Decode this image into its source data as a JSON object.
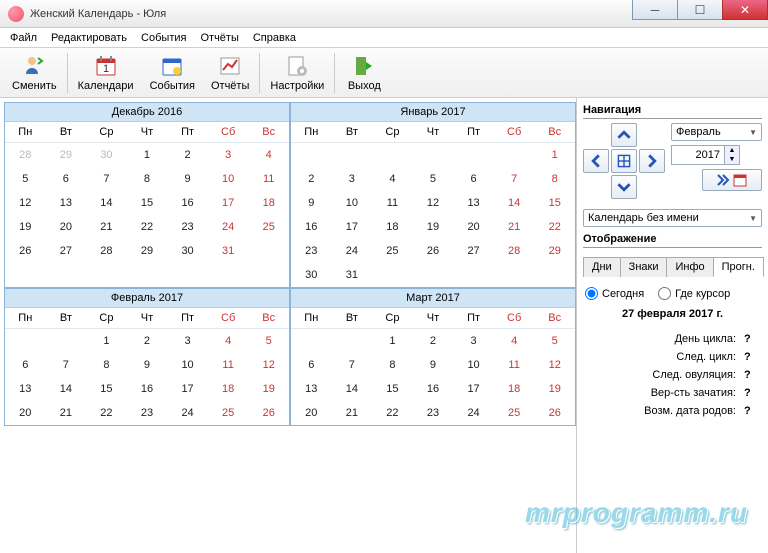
{
  "window": {
    "title": "Женский Календарь - Юля"
  },
  "menu": {
    "file": "Файл",
    "edit": "Редактировать",
    "events": "События",
    "reports": "Отчёты",
    "help": "Справка"
  },
  "toolbar": {
    "change": "Сменить",
    "calendars": "Календари",
    "events": "События",
    "reports": "Отчёты",
    "settings": "Настройки",
    "exit": "Выход"
  },
  "dow": [
    "Пн",
    "Вт",
    "Ср",
    "Чт",
    "Пт",
    "Сб",
    "Вс"
  ],
  "months": [
    {
      "title": "Декабрь  2016",
      "cells": [
        {
          "d": "28",
          "o": 1
        },
        {
          "d": "29",
          "o": 1
        },
        {
          "d": "30",
          "o": 1
        },
        {
          "d": "1"
        },
        {
          "d": "2"
        },
        {
          "d": "3",
          "w": 1
        },
        {
          "d": "4",
          "w": 1
        },
        {
          "d": "5"
        },
        {
          "d": "6"
        },
        {
          "d": "7"
        },
        {
          "d": "8"
        },
        {
          "d": "9"
        },
        {
          "d": "10",
          "w": 1
        },
        {
          "d": "11",
          "w": 1
        },
        {
          "d": "12"
        },
        {
          "d": "13"
        },
        {
          "d": "14"
        },
        {
          "d": "15"
        },
        {
          "d": "16"
        },
        {
          "d": "17",
          "w": 1
        },
        {
          "d": "18",
          "w": 1
        },
        {
          "d": "19"
        },
        {
          "d": "20"
        },
        {
          "d": "21"
        },
        {
          "d": "22"
        },
        {
          "d": "23"
        },
        {
          "d": "24",
          "w": 1
        },
        {
          "d": "25",
          "w": 1
        },
        {
          "d": "26"
        },
        {
          "d": "27"
        },
        {
          "d": "28"
        },
        {
          "d": "29"
        },
        {
          "d": "30"
        },
        {
          "d": "31",
          "w": 1
        },
        {
          "d": "",
          "e": 1
        }
      ]
    },
    {
      "title": "Январь  2017",
      "cells": [
        {
          "d": "",
          "e": 1
        },
        {
          "d": "",
          "e": 1
        },
        {
          "d": "",
          "e": 1
        },
        {
          "d": "",
          "e": 1
        },
        {
          "d": "",
          "e": 1
        },
        {
          "d": "",
          "e": 1
        },
        {
          "d": "1",
          "w": 1
        },
        {
          "d": "2"
        },
        {
          "d": "3"
        },
        {
          "d": "4"
        },
        {
          "d": "5"
        },
        {
          "d": "6"
        },
        {
          "d": "7",
          "w": 1
        },
        {
          "d": "8",
          "w": 1
        },
        {
          "d": "9"
        },
        {
          "d": "10"
        },
        {
          "d": "11"
        },
        {
          "d": "12"
        },
        {
          "d": "13"
        },
        {
          "d": "14",
          "w": 1
        },
        {
          "d": "15",
          "w": 1
        },
        {
          "d": "16"
        },
        {
          "d": "17"
        },
        {
          "d": "18"
        },
        {
          "d": "19"
        },
        {
          "d": "20"
        },
        {
          "d": "21",
          "w": 1
        },
        {
          "d": "22",
          "w": 1
        },
        {
          "d": "23"
        },
        {
          "d": "24"
        },
        {
          "d": "25"
        },
        {
          "d": "26"
        },
        {
          "d": "27"
        },
        {
          "d": "28",
          "w": 1
        },
        {
          "d": "29",
          "w": 1
        },
        {
          "d": "30"
        },
        {
          "d": "31"
        },
        {
          "d": "",
          "e": 1
        },
        {
          "d": "",
          "e": 1
        },
        {
          "d": "",
          "e": 1
        },
        {
          "d": "",
          "e": 1
        },
        {
          "d": "",
          "e": 1
        }
      ]
    },
    {
      "title": "Февраль  2017",
      "cells": [
        {
          "d": "",
          "e": 1
        },
        {
          "d": "",
          "e": 1
        },
        {
          "d": "1"
        },
        {
          "d": "2"
        },
        {
          "d": "3"
        },
        {
          "d": "4",
          "w": 1
        },
        {
          "d": "5",
          "w": 1
        },
        {
          "d": "6"
        },
        {
          "d": "7"
        },
        {
          "d": "8"
        },
        {
          "d": "9"
        },
        {
          "d": "10"
        },
        {
          "d": "11",
          "w": 1
        },
        {
          "d": "12",
          "w": 1
        },
        {
          "d": "13"
        },
        {
          "d": "14"
        },
        {
          "d": "15"
        },
        {
          "d": "16"
        },
        {
          "d": "17"
        },
        {
          "d": "18",
          "w": 1
        },
        {
          "d": "19",
          "w": 1
        },
        {
          "d": "20"
        },
        {
          "d": "21"
        },
        {
          "d": "22"
        },
        {
          "d": "23"
        },
        {
          "d": "24"
        },
        {
          "d": "25",
          "w": 1
        },
        {
          "d": "26",
          "w": 1
        }
      ]
    },
    {
      "title": "Март  2017",
      "cells": [
        {
          "d": "",
          "e": 1
        },
        {
          "d": "",
          "e": 1
        },
        {
          "d": "1"
        },
        {
          "d": "2"
        },
        {
          "d": "3"
        },
        {
          "d": "4",
          "w": 1
        },
        {
          "d": "5",
          "w": 1
        },
        {
          "d": "6"
        },
        {
          "d": "7"
        },
        {
          "d": "8"
        },
        {
          "d": "9"
        },
        {
          "d": "10"
        },
        {
          "d": "11",
          "w": 1
        },
        {
          "d": "12",
          "w": 1
        },
        {
          "d": "13"
        },
        {
          "d": "14"
        },
        {
          "d": "15"
        },
        {
          "d": "16"
        },
        {
          "d": "17"
        },
        {
          "d": "18",
          "w": 1
        },
        {
          "d": "19",
          "w": 1
        },
        {
          "d": "20"
        },
        {
          "d": "21"
        },
        {
          "d": "22"
        },
        {
          "d": "23"
        },
        {
          "d": "24"
        },
        {
          "d": "25",
          "w": 1
        },
        {
          "d": "26",
          "w": 1
        }
      ]
    }
  ],
  "nav": {
    "title": "Навигация",
    "month_select": "Февраль",
    "year": "2017"
  },
  "calname": {
    "value": "Календарь без имени"
  },
  "display": {
    "title": "Отображение",
    "tabs": {
      "days": "Дни",
      "signs": "Знаки",
      "info": "Инфо",
      "forecast": "Прогн."
    },
    "radio_today": "Сегодня",
    "radio_cursor": "Где курсор",
    "date": "27 февраля 2017 г.",
    "rows": [
      {
        "k": "День цикла:",
        "v": "?"
      },
      {
        "k": "След. цикл:",
        "v": "?"
      },
      {
        "k": "След. овуляция:",
        "v": "?"
      },
      {
        "k": "Вер-сть зачатия:",
        "v": "?"
      },
      {
        "k": "Возм. дата родов:",
        "v": "?"
      }
    ]
  },
  "watermark": "mrprogramm.ru"
}
